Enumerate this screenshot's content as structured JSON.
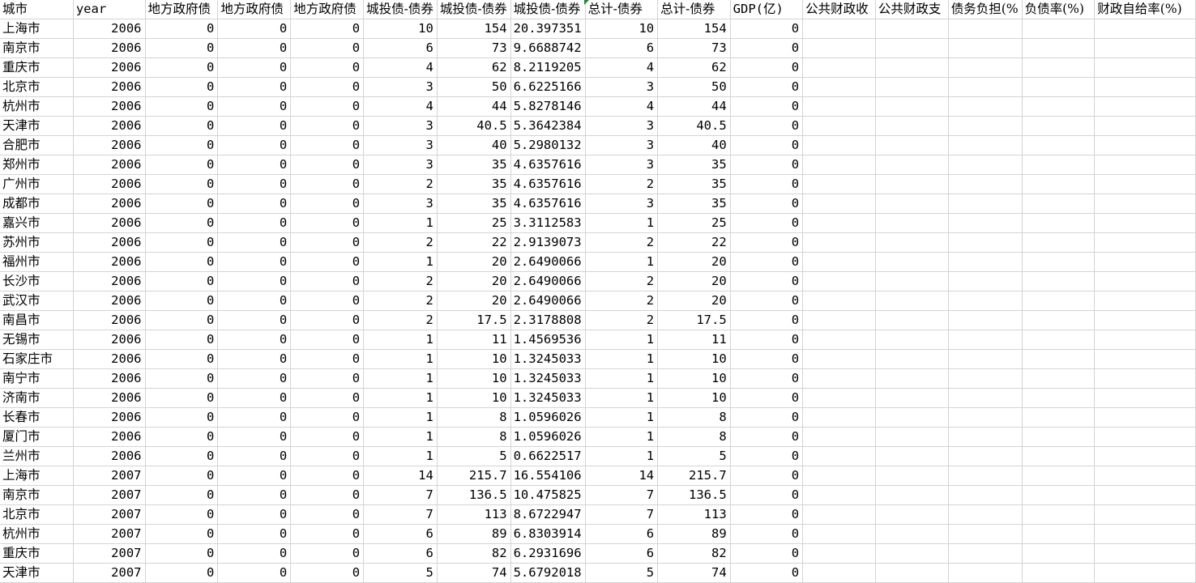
{
  "headers": [
    "城市",
    "year",
    "地方政府债",
    "地方政府债",
    "地方政府债",
    "城投债-债券",
    "城投债-债券",
    "城投债-债券",
    "总计-债券",
    "总计-债券",
    "GDP(亿)",
    "公共财政收",
    "公共财政支",
    "债务负担(%",
    "负债率(%)",
    "财政自给率(%)"
  ],
  "rows": [
    [
      "上海市",
      "2006",
      "0",
      "0",
      "0",
      "10",
      "154",
      "20.397351",
      "10",
      "154",
      "0",
      "",
      "",
      "",
      "",
      ""
    ],
    [
      "南京市",
      "2006",
      "0",
      "0",
      "0",
      "6",
      "73",
      "9.6688742",
      "6",
      "73",
      "0",
      "",
      "",
      "",
      "",
      ""
    ],
    [
      "重庆市",
      "2006",
      "0",
      "0",
      "0",
      "4",
      "62",
      "8.2119205",
      "4",
      "62",
      "0",
      "",
      "",
      "",
      "",
      ""
    ],
    [
      "北京市",
      "2006",
      "0",
      "0",
      "0",
      "3",
      "50",
      "6.6225166",
      "3",
      "50",
      "0",
      "",
      "",
      "",
      "",
      ""
    ],
    [
      "杭州市",
      "2006",
      "0",
      "0",
      "0",
      "4",
      "44",
      "5.8278146",
      "4",
      "44",
      "0",
      "",
      "",
      "",
      "",
      ""
    ],
    [
      "天津市",
      "2006",
      "0",
      "0",
      "0",
      "3",
      "40.5",
      "5.3642384",
      "3",
      "40.5",
      "0",
      "",
      "",
      "",
      "",
      ""
    ],
    [
      "合肥市",
      "2006",
      "0",
      "0",
      "0",
      "3",
      "40",
      "5.2980132",
      "3",
      "40",
      "0",
      "",
      "",
      "",
      "",
      ""
    ],
    [
      "郑州市",
      "2006",
      "0",
      "0",
      "0",
      "3",
      "35",
      "4.6357616",
      "3",
      "35",
      "0",
      "",
      "",
      "",
      "",
      ""
    ],
    [
      "广州市",
      "2006",
      "0",
      "0",
      "0",
      "2",
      "35",
      "4.6357616",
      "2",
      "35",
      "0",
      "",
      "",
      "",
      "",
      ""
    ],
    [
      "成都市",
      "2006",
      "0",
      "0",
      "0",
      "3",
      "35",
      "4.6357616",
      "3",
      "35",
      "0",
      "",
      "",
      "",
      "",
      ""
    ],
    [
      "嘉兴市",
      "2006",
      "0",
      "0",
      "0",
      "1",
      "25",
      "3.3112583",
      "1",
      "25",
      "0",
      "",
      "",
      "",
      "",
      ""
    ],
    [
      "苏州市",
      "2006",
      "0",
      "0",
      "0",
      "2",
      "22",
      "2.9139073",
      "2",
      "22",
      "0",
      "",
      "",
      "",
      "",
      ""
    ],
    [
      "福州市",
      "2006",
      "0",
      "0",
      "0",
      "1",
      "20",
      "2.6490066",
      "1",
      "20",
      "0",
      "",
      "",
      "",
      "",
      ""
    ],
    [
      "长沙市",
      "2006",
      "0",
      "0",
      "0",
      "2",
      "20",
      "2.6490066",
      "2",
      "20",
      "0",
      "",
      "",
      "",
      "",
      ""
    ],
    [
      "武汉市",
      "2006",
      "0",
      "0",
      "0",
      "2",
      "20",
      "2.6490066",
      "2",
      "20",
      "0",
      "",
      "",
      "",
      "",
      ""
    ],
    [
      "南昌市",
      "2006",
      "0",
      "0",
      "0",
      "2",
      "17.5",
      "2.3178808",
      "2",
      "17.5",
      "0",
      "",
      "",
      "",
      "",
      ""
    ],
    [
      "无锡市",
      "2006",
      "0",
      "0",
      "0",
      "1",
      "11",
      "1.4569536",
      "1",
      "11",
      "0",
      "",
      "",
      "",
      "",
      ""
    ],
    [
      "石家庄市",
      "2006",
      "0",
      "0",
      "0",
      "1",
      "10",
      "1.3245033",
      "1",
      "10",
      "0",
      "",
      "",
      "",
      "",
      ""
    ],
    [
      "南宁市",
      "2006",
      "0",
      "0",
      "0",
      "1",
      "10",
      "1.3245033",
      "1",
      "10",
      "0",
      "",
      "",
      "",
      "",
      ""
    ],
    [
      "济南市",
      "2006",
      "0",
      "0",
      "0",
      "1",
      "10",
      "1.3245033",
      "1",
      "10",
      "0",
      "",
      "",
      "",
      "",
      ""
    ],
    [
      "长春市",
      "2006",
      "0",
      "0",
      "0",
      "1",
      "8",
      "1.0596026",
      "1",
      "8",
      "0",
      "",
      "",
      "",
      "",
      ""
    ],
    [
      "厦门市",
      "2006",
      "0",
      "0",
      "0",
      "1",
      "8",
      "1.0596026",
      "1",
      "8",
      "0",
      "",
      "",
      "",
      "",
      ""
    ],
    [
      "兰州市",
      "2006",
      "0",
      "0",
      "0",
      "1",
      "5",
      "0.6622517",
      "1",
      "5",
      "0",
      "",
      "",
      "",
      "",
      ""
    ],
    [
      "上海市",
      "2007",
      "0",
      "0",
      "0",
      "14",
      "215.7",
      "16.554106",
      "14",
      "215.7",
      "0",
      "",
      "",
      "",
      "",
      ""
    ],
    [
      "南京市",
      "2007",
      "0",
      "0",
      "0",
      "7",
      "136.5",
      "10.475825",
      "7",
      "136.5",
      "0",
      "",
      "",
      "",
      "",
      ""
    ],
    [
      "北京市",
      "2007",
      "0",
      "0",
      "0",
      "7",
      "113",
      "8.6722947",
      "7",
      "113",
      "0",
      "",
      "",
      "",
      "",
      ""
    ],
    [
      "杭州市",
      "2007",
      "0",
      "0",
      "0",
      "6",
      "89",
      "6.8303914",
      "6",
      "89",
      "0",
      "",
      "",
      "",
      "",
      ""
    ],
    [
      "重庆市",
      "2007",
      "0",
      "0",
      "0",
      "6",
      "82",
      "6.2931696",
      "6",
      "82",
      "0",
      "",
      "",
      "",
      "",
      ""
    ],
    [
      "天津市",
      "2007",
      "0",
      "0",
      "0",
      "5",
      "74",
      "5.6792018",
      "5",
      "74",
      "0",
      "",
      "",
      "",
      "",
      ""
    ]
  ]
}
